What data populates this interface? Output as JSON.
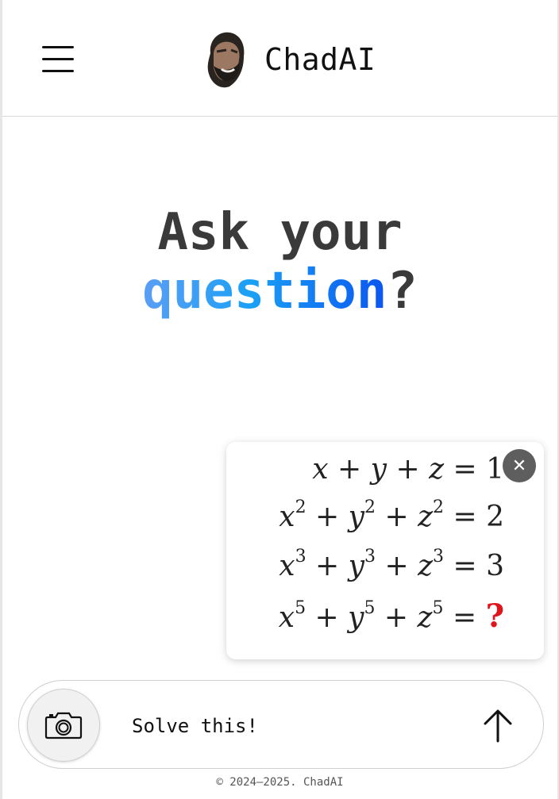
{
  "header": {
    "brand_name": "ChadAI",
    "menu_icon": "hamburger-menu-icon",
    "avatar": "chad-face-avatar"
  },
  "hero": {
    "line1": "Ask your",
    "highlight": "question",
    "punct": "?"
  },
  "attachment": {
    "image_name": "equation-image",
    "equations": [
      {
        "lhs": [
          "x",
          "+",
          "y",
          "+",
          "z"
        ],
        "powers": [
          "",
          "",
          ""
        ],
        "rhs": "1"
      },
      {
        "lhs": [
          "x",
          "+",
          "y",
          "+",
          "z"
        ],
        "powers": [
          "2",
          "2",
          "2"
        ],
        "rhs": "2"
      },
      {
        "lhs": [
          "x",
          "+",
          "y",
          "+",
          "z"
        ],
        "powers": [
          "3",
          "3",
          "3"
        ],
        "rhs": "3"
      },
      {
        "lhs": [
          "x",
          "+",
          "y",
          "+",
          "z"
        ],
        "powers": [
          "5",
          "5",
          "5"
        ],
        "rhs": "?"
      }
    ],
    "rhs_unknown_color": "#e0151b",
    "close_icon": "close-icon"
  },
  "composer": {
    "input_value": "Solve this!",
    "camera_icon": "camera-icon",
    "send_icon": "arrow-up-icon"
  },
  "footer": {
    "copyright": "© 2024–2025. ChadAI"
  },
  "colors": {
    "gradient_start": "#5b9ef5",
    "gradient_end": "#0b55f0",
    "text_dark": "#3a3a3a"
  }
}
